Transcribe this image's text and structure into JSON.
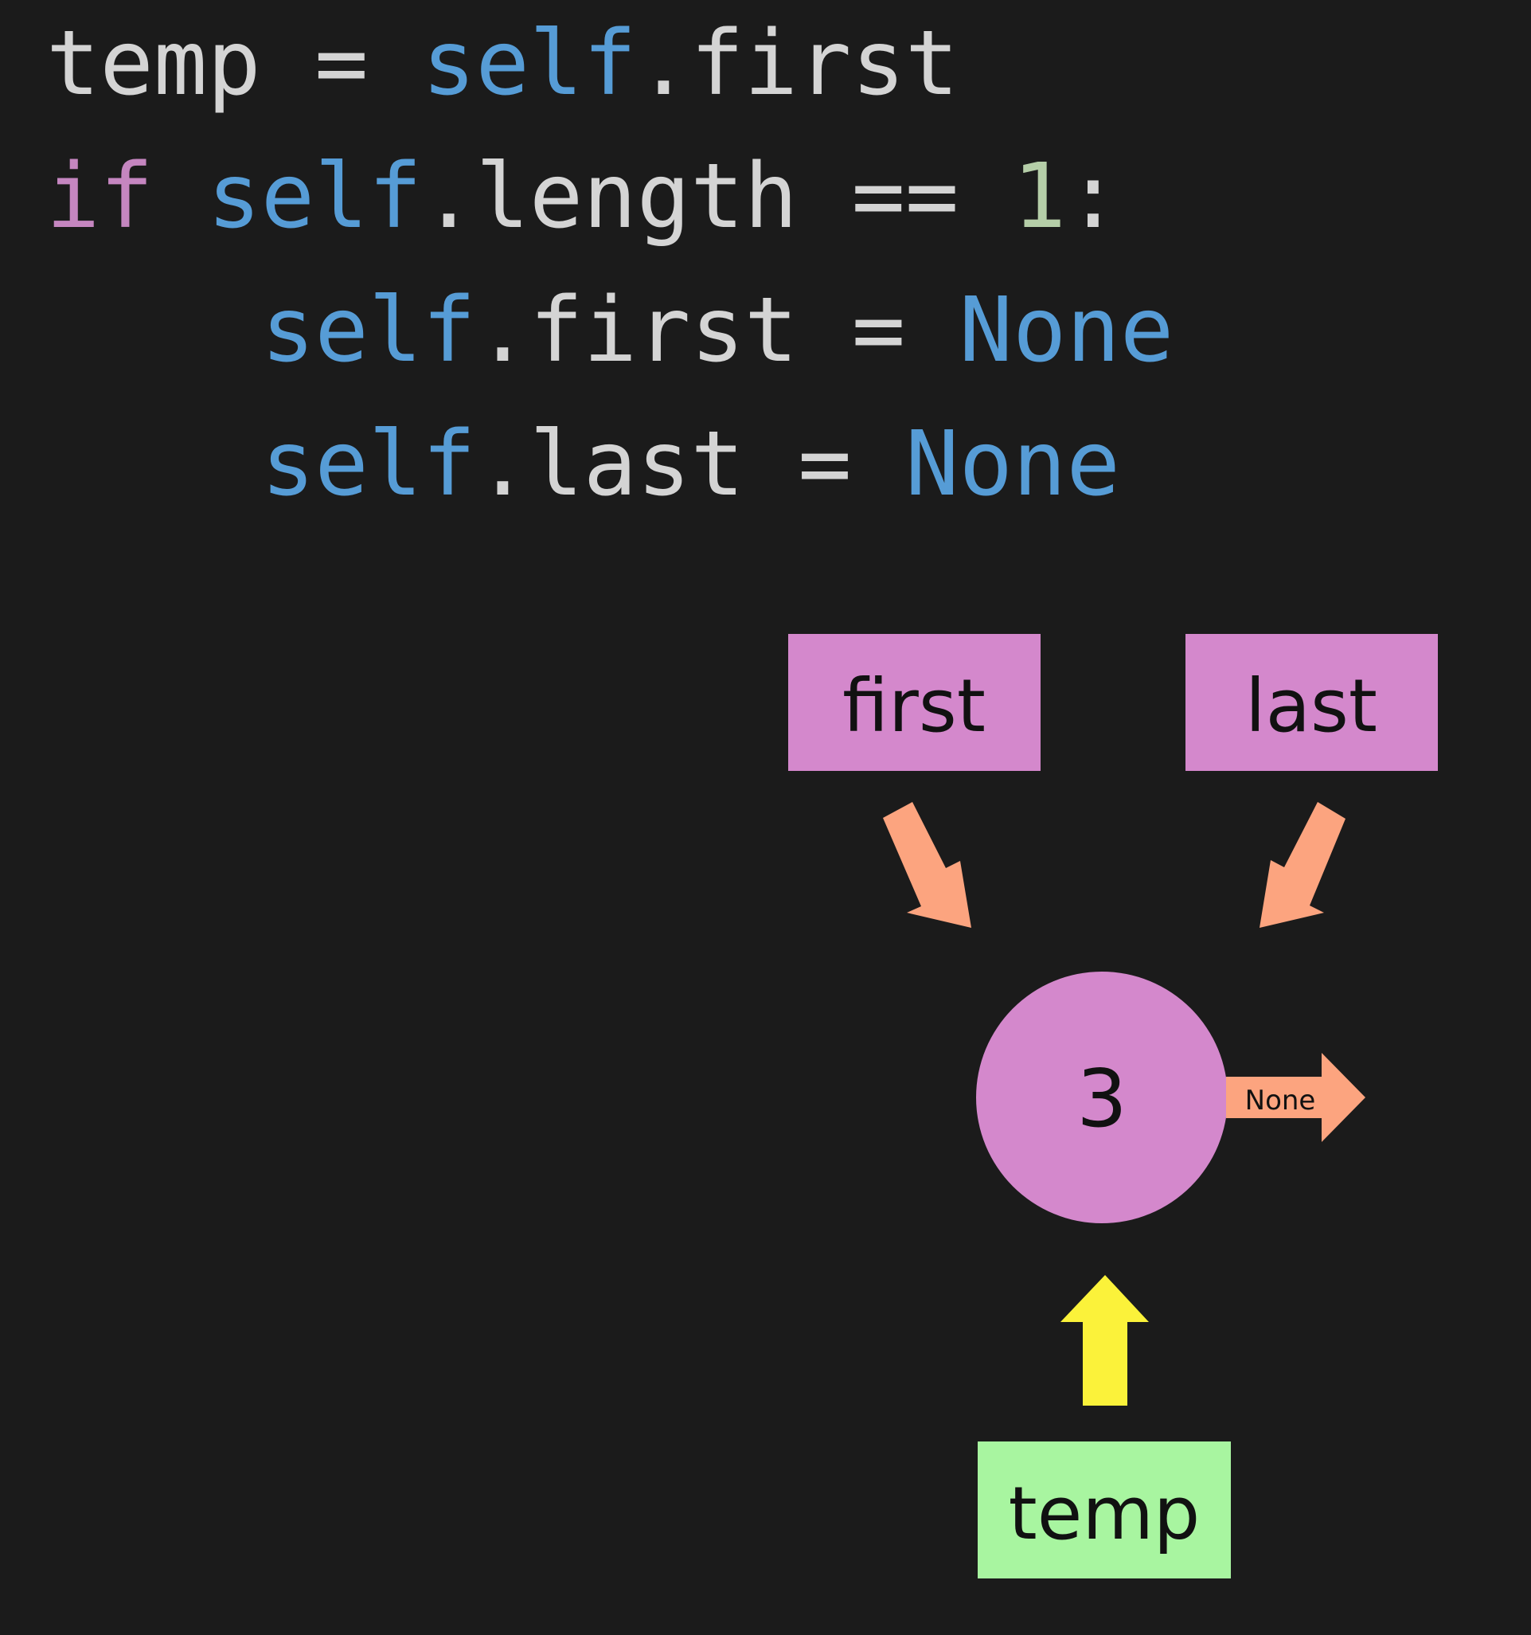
{
  "code": {
    "line1": {
      "var": "temp",
      "op": " = ",
      "self": "self",
      "attr": ".first"
    },
    "line2": {
      "keyword": "if",
      "space": " ",
      "self": "self",
      "attr": ".length",
      "op": " == ",
      "number": "1",
      "colon": ":"
    },
    "line3": {
      "self": "self",
      "attr": ".first",
      "op": " = ",
      "value": "None"
    },
    "line4": {
      "self": "self",
      "attr": ".last",
      "op": " = ",
      "value": "None"
    }
  },
  "diagram": {
    "pointers": {
      "first_label": "first",
      "last_label": "last",
      "temp_label": "temp"
    },
    "node": {
      "value": "3",
      "next_label": "None"
    }
  },
  "colors": {
    "background": "#1b1b1b",
    "pointer_box": "#d488cc",
    "node_fill": "#d488cc",
    "temp_box": "#a8f5a0",
    "pointer_arrow": "#fca47f",
    "temp_arrow": "#fbf23a",
    "keyword_blue": "#569cd6",
    "keyword_pink": "#c586c0",
    "number_green": "#b5cea8"
  }
}
